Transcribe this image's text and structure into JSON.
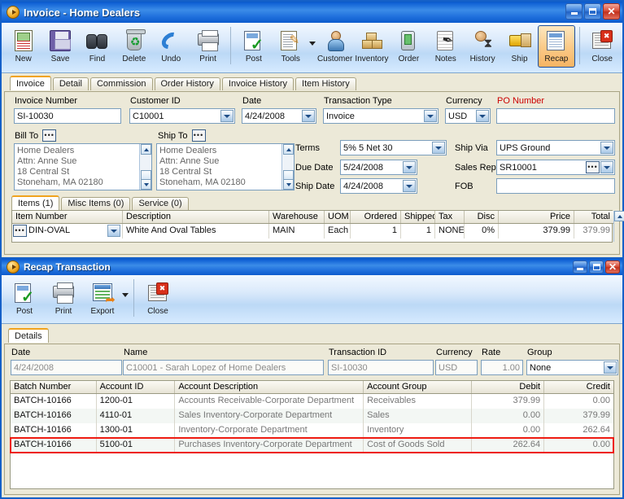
{
  "invoice_window": {
    "title": "Invoice - Home Dealers",
    "window_buttons": {
      "minimize": "_",
      "maximize": "□",
      "close": "✕"
    },
    "toolbar": [
      {
        "label": "New",
        "icon": "new-document-icon"
      },
      {
        "label": "Save",
        "icon": "floppy-disk-icon"
      },
      {
        "label": "Find",
        "icon": "binoculars-icon"
      },
      {
        "label": "Delete",
        "icon": "recycle-bin-icon"
      },
      {
        "label": "Undo",
        "icon": "undo-arrow-icon"
      },
      {
        "label": "Print",
        "icon": "printer-icon"
      },
      {
        "label": "Post",
        "icon": "post-checkmark-icon"
      },
      {
        "label": "Tools",
        "icon": "tools-icon"
      },
      {
        "label": "Customer",
        "icon": "customer-person-icon"
      },
      {
        "label": "Inventory",
        "icon": "inventory-boxes-icon"
      },
      {
        "label": "Order",
        "icon": "order-device-icon"
      },
      {
        "label": "Notes",
        "icon": "notepad-pen-icon"
      },
      {
        "label": "History",
        "icon": "history-hourglass-icon"
      },
      {
        "label": "Ship",
        "icon": "forklift-ship-icon"
      },
      {
        "label": "Recap",
        "icon": "recap-report-icon",
        "selected": true
      },
      {
        "label": "Close",
        "icon": "close-window-icon"
      }
    ],
    "tabs": [
      {
        "label": "Invoice",
        "active": true
      },
      {
        "label": "Detail",
        "active": false
      },
      {
        "label": "Commission",
        "active": false
      },
      {
        "label": "Order History",
        "active": false
      },
      {
        "label": "Invoice History",
        "active": false
      },
      {
        "label": "Item History",
        "active": false
      }
    ],
    "fields": {
      "invoice_number_label": "Invoice Number",
      "invoice_number_value": "SI-10030",
      "customer_id_label": "Customer ID",
      "customer_id_value": "C10001",
      "date_label": "Date",
      "date_value": "4/24/2008",
      "transaction_type_label": "Transaction Type",
      "transaction_type_value": "Invoice",
      "currency_label": "Currency",
      "currency_value": "USD",
      "po_number_label": "PO Number",
      "po_number_value": "",
      "bill_to_label": "Bill To",
      "bill_to_address": "Home Dealers\nAttn: Anne Sue\n18 Central St\nStoneham, MA 02180",
      "ship_to_label": "Ship To",
      "ship_to_address": "Home Dealers\nAttn: Anne Sue\n18 Central St\nStoneham, MA 02180",
      "terms_label": "Terms",
      "terms_value": "5% 5 Net 30",
      "due_date_label": "Due Date",
      "due_date_value": "5/24/2008",
      "ship_date_label": "Ship Date",
      "ship_date_value": "4/24/2008",
      "ship_via_label": "Ship Via",
      "ship_via_value": "UPS Ground",
      "sales_rep_label": "Sales Rep",
      "sales_rep_value": "SR10001",
      "fob_label": "FOB",
      "fob_value": ""
    },
    "item_tabs": [
      {
        "label": "Items (1)",
        "active": true
      },
      {
        "label": "Misc Items (0)",
        "active": false
      },
      {
        "label": "Service (0)",
        "active": false
      }
    ],
    "item_grid": {
      "columns": [
        "Item Number",
        "Description",
        "Warehouse",
        "UOM",
        "Ordered",
        "Shipped",
        "Tax",
        "Disc",
        "Price",
        "Total"
      ],
      "rows": [
        {
          "item_number": "DIN-OVAL",
          "description": "White And Oval Tables",
          "warehouse": "MAIN",
          "uom": "Each",
          "ordered": "1",
          "shipped": "1",
          "tax": "NONE",
          "disc": "0%",
          "price": "379.99",
          "total": "379.99"
        }
      ]
    }
  },
  "recap_window": {
    "title": "Recap Transaction",
    "window_buttons": {
      "minimize": "_",
      "maximize": "□",
      "close": "✕"
    },
    "toolbar": [
      {
        "label": "Post",
        "icon": "post-checkmark-icon"
      },
      {
        "label": "Print",
        "icon": "printer-icon"
      },
      {
        "label": "Export",
        "icon": "export-icon"
      },
      {
        "label": "Close",
        "icon": "close-window-icon"
      }
    ],
    "tabs": [
      {
        "label": "Details",
        "active": true
      }
    ],
    "fields": {
      "date_label": "Date",
      "date_value": "4/24/2008",
      "name_label": "Name",
      "name_value": "C10001 - Sarah Lopez of Home Dealers",
      "transaction_id_label": "Transaction ID",
      "transaction_id_value": "SI-10030",
      "currency_label": "Currency",
      "currency_value": "USD",
      "rate_label": "Rate",
      "rate_value": "1.00",
      "group_label": "Group",
      "group_value": "None"
    },
    "grid": {
      "columns": [
        "Batch Number",
        "Account ID",
        "Account Description",
        "Account Group",
        "Debit",
        "Credit"
      ],
      "rows": [
        {
          "batch_number": "BATCH-10166",
          "account_id": "1200-01",
          "account_description": "Accounts Receivable-Corporate Department",
          "account_group": "Receivables",
          "debit": "379.99",
          "credit": "0.00",
          "highlighted": false
        },
        {
          "batch_number": "BATCH-10166",
          "account_id": "4110-01",
          "account_description": "Sales Inventory-Corporate Department",
          "account_group": "Sales",
          "debit": "0.00",
          "credit": "379.99",
          "highlighted": false
        },
        {
          "batch_number": "BATCH-10166",
          "account_id": "1300-01",
          "account_description": "Inventory-Corporate Department",
          "account_group": "Inventory",
          "debit": "0.00",
          "credit": "262.64",
          "highlighted": false
        },
        {
          "batch_number": "BATCH-10166",
          "account_id": "5100-01",
          "account_description": "Purchases Inventory-Corporate Department",
          "account_group": "Cost of Goods Sold",
          "debit": "262.64",
          "credit": "0.00",
          "highlighted": true
        }
      ]
    }
  },
  "colors": {
    "titlebar_blue": "#1263d6",
    "selected_button": "#f6b463",
    "highlight_row_border": "#ee1b12",
    "required_label": "#cc0000",
    "tab_active_accent": "#f0a31e"
  }
}
